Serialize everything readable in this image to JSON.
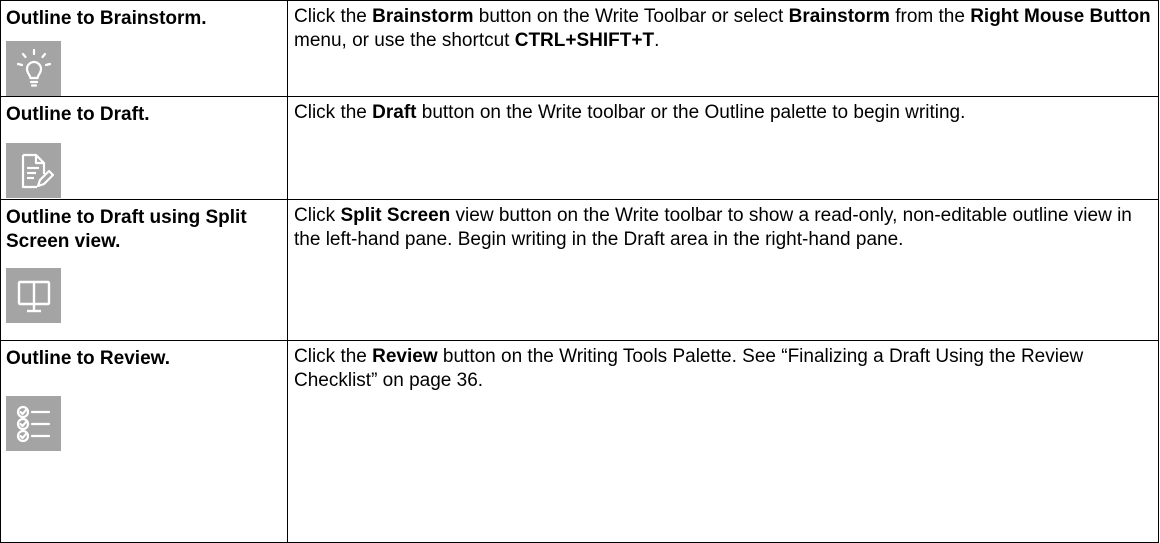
{
  "rows": [
    {
      "term": "Outline to Brainstorm.",
      "icon": "lightbulb-icon",
      "desc": [
        {
          "t": " Click the ",
          "b": false
        },
        {
          "t": "Brainstorm",
          "b": true
        },
        {
          "t": " button on the Write Toolbar or select ",
          "b": false
        },
        {
          "t": "Brainstorm",
          "b": true
        },
        {
          "t": " from the ",
          "b": false
        },
        {
          "t": "Right Mouse Button",
          "b": true
        },
        {
          "t": " menu, or use the shortcut ",
          "b": false
        },
        {
          "t": "CTRL+SHIFT+T",
          "b": true
        },
        {
          "t": ".",
          "b": false
        }
      ]
    },
    {
      "term": "Outline to Draft.",
      "icon": "draft-document-pen-icon",
      "desc": [
        {
          "t": "Click the ",
          "b": false
        },
        {
          "t": "Draft",
          "b": true
        },
        {
          "t": " button on the Write toolbar or the Outline palette to begin writing.",
          "b": false
        }
      ]
    },
    {
      "term": "Outline to Draft using Split Screen view.",
      "icon": "split-screen-monitor-icon",
      "desc": [
        {
          "t": "Click ",
          "b": false
        },
        {
          "t": "Split Screen",
          "b": true
        },
        {
          "t": " view button on the Write toolbar to show a read-only, non-editable outline view in the left-hand pane. Begin writing in the Draft area in the right-hand pane.",
          "b": false
        }
      ]
    },
    {
      "term": "Outline to Review.",
      "icon": "review-checklist-icon",
      "desc": [
        {
          "t": "Click the ",
          "b": false
        },
        {
          "t": "Review",
          "b": true
        },
        {
          "t": " button on the Writing Tools Palette. See “Finalizing a Draft Using the Review Checklist” on page 36.",
          "b": false
        }
      ]
    }
  ]
}
